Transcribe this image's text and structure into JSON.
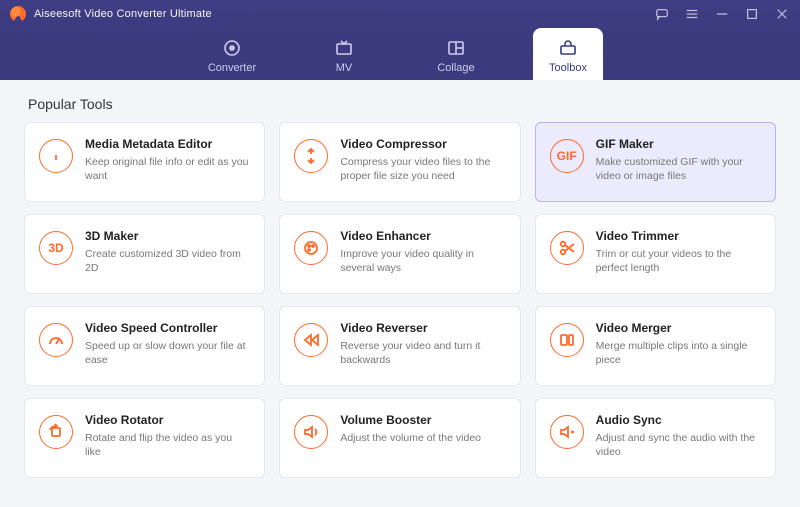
{
  "app": {
    "title": "Aiseesoft Video Converter Ultimate"
  },
  "nav": {
    "tabs": [
      {
        "id": "converter",
        "label": "Converter",
        "active": false
      },
      {
        "id": "mv",
        "label": "MV",
        "active": false
      },
      {
        "id": "collage",
        "label": "Collage",
        "active": false
      },
      {
        "id": "toolbox",
        "label": "Toolbox",
        "active": true
      }
    ]
  },
  "section": {
    "title": "Popular Tools"
  },
  "tools": [
    {
      "id": "metadata",
      "title": "Media Metadata Editor",
      "desc": "Keep original file info or edit as you want",
      "icon": "info-icon",
      "selected": false
    },
    {
      "id": "compressor",
      "title": "Video Compressor",
      "desc": "Compress your video files to the proper file size you need",
      "icon": "compress-icon",
      "selected": false
    },
    {
      "id": "gifmaker",
      "title": "GIF Maker",
      "desc": "Make customized GIF with your video or image files",
      "icon": "gif-icon",
      "selected": true,
      "glyph": "GIF"
    },
    {
      "id": "3dmaker",
      "title": "3D Maker",
      "desc": "Create customized 3D video from 2D",
      "icon": "3d-icon",
      "selected": false,
      "glyph": "3D"
    },
    {
      "id": "enhancer",
      "title": "Video Enhancer",
      "desc": "Improve your video quality in several ways",
      "icon": "palette-icon",
      "selected": false
    },
    {
      "id": "trimmer",
      "title": "Video Trimmer",
      "desc": "Trim or cut your videos to the perfect length",
      "icon": "scissors-icon",
      "selected": false
    },
    {
      "id": "speed",
      "title": "Video Speed Controller",
      "desc": "Speed up or slow down your file at ease",
      "icon": "gauge-icon",
      "selected": false
    },
    {
      "id": "reverser",
      "title": "Video Reverser",
      "desc": "Reverse your video and turn it backwards",
      "icon": "rewind-icon",
      "selected": false
    },
    {
      "id": "merger",
      "title": "Video Merger",
      "desc": "Merge multiple clips into a single piece",
      "icon": "merge-icon",
      "selected": false
    },
    {
      "id": "rotator",
      "title": "Video Rotator",
      "desc": "Rotate and flip the video as you like",
      "icon": "rotate-icon",
      "selected": false
    },
    {
      "id": "volume",
      "title": "Volume Booster",
      "desc": "Adjust the volume of the video",
      "icon": "volume-icon",
      "selected": false
    },
    {
      "id": "audiosync",
      "title": "Audio Sync",
      "desc": "Adjust and sync the audio with the video",
      "icon": "audiosync-icon",
      "selected": false
    }
  ],
  "colors": {
    "accent": "#ff6a2c",
    "header": "#3e3c82",
    "selected_bg": "#eceafd"
  }
}
